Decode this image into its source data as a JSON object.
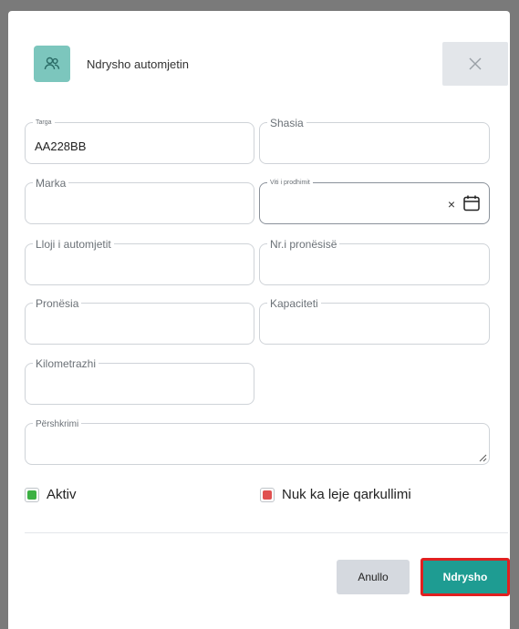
{
  "dialog": {
    "title": "Ndrysho automjetin",
    "header_icon": "users-icon",
    "close_icon": "close-icon"
  },
  "fields": {
    "targa": {
      "label": "Targa",
      "value": "AA228BB"
    },
    "shasia": {
      "label": "Shasia",
      "value": ""
    },
    "marka": {
      "label": "Marka",
      "value": ""
    },
    "viti": {
      "label": "Viti i prodhimit",
      "value": "",
      "clear": "×",
      "icon": "calendar-icon"
    },
    "lloji": {
      "label": "Lloji i automjetit",
      "value": ""
    },
    "nr_pronesise": {
      "label": "Nr.i pronësisë",
      "value": ""
    },
    "pronesia": {
      "label": "Pronësia",
      "value": ""
    },
    "kapaciteti": {
      "label": "Kapaciteti",
      "value": ""
    },
    "kilometrazhi": {
      "label": "Kilometrazhi",
      "value": ""
    },
    "pershkrimi": {
      "label": "Përshkrimi",
      "value": ""
    }
  },
  "checkboxes": {
    "aktiv": {
      "label": "Aktiv",
      "color": "#3cb043"
    },
    "nuk_ka_leje": {
      "label": "Nuk ka leje qarkullimi",
      "color": "#e05050"
    }
  },
  "buttons": {
    "cancel": "Anullo",
    "submit": "Ndrysho"
  },
  "colors": {
    "accent": "#1e9c92",
    "icon_bg": "#7cc6bd",
    "highlight": "#e02020"
  }
}
